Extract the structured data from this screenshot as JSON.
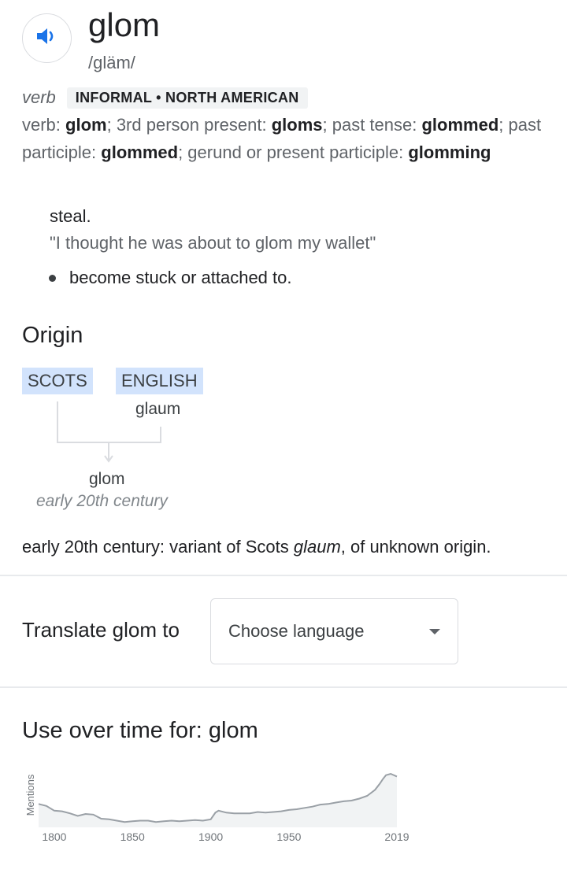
{
  "entry": {
    "speaker_icon": "speaker-icon",
    "headword": "glom",
    "phonetic": "/gläm/",
    "part_of_speech": "verb",
    "register": "INFORMAL • NORTH AMERICAN"
  },
  "forms": {
    "verb_label": "verb: ",
    "verb": "glom",
    "third_label": "; 3rd person present: ",
    "third": "gloms",
    "past_label": "; past tense: ",
    "past": "glommed",
    "pp_label": "; past participle: ",
    "pp": "glommed",
    "gerund_label": "; gerund or present participle: ",
    "gerund": "glomming"
  },
  "senses": {
    "definition": "steal.",
    "example": "\"I thought he was about to glom my wallet\"",
    "sub_sense": "become stuck or attached to."
  },
  "origin": {
    "title": "Origin",
    "languages": [
      "SCOTS",
      "ENGLISH"
    ],
    "source_word": "glaum",
    "result_word": "glom",
    "period": "early 20th century",
    "text_prefix": "early 20th century: variant of Scots ",
    "text_italic": "glaum",
    "text_suffix": ", of unknown origin."
  },
  "translate": {
    "label": "Translate glom to",
    "select_value": "Choose language",
    "caret_icon": "caret-down-icon"
  },
  "usage": {
    "title": "Use over time for: glom"
  },
  "chart_data": {
    "type": "area",
    "title": "",
    "xlabel": "",
    "ylabel": "Mentions",
    "x_ticks": [
      "1800",
      "1850",
      "1900",
      "1950",
      "2019"
    ],
    "xlim": [
      1790,
      2019
    ],
    "ylim": [
      0,
      100
    ],
    "grid": false,
    "color": "#9aa0a6",
    "fill": "#f1f3f4",
    "series": [
      {
        "x": [
          1790,
          1795,
          1800,
          1805,
          1810,
          1815,
          1820,
          1825,
          1830,
          1835,
          1840,
          1845,
          1850,
          1855,
          1860,
          1865,
          1870,
          1875,
          1880,
          1885,
          1890,
          1895,
          1900,
          1903,
          1905,
          1910,
          1915,
          1920,
          1925,
          1930,
          1935,
          1940,
          1945,
          1950,
          1955,
          1960,
          1965,
          1970,
          1975,
          1980,
          1985,
          1990,
          1995,
          2000,
          2005,
          2008,
          2010,
          2012,
          2015,
          2019
        ],
        "values": [
          35,
          32,
          25,
          24,
          21,
          17,
          20,
          19,
          13,
          12,
          10,
          8,
          9,
          10,
          10,
          8,
          9,
          10,
          9,
          10,
          11,
          10,
          12,
          22,
          25,
          22,
          21,
          21,
          21,
          23,
          22,
          23,
          24,
          26,
          27,
          29,
          31,
          34,
          35,
          37,
          39,
          40,
          43,
          47,
          56,
          65,
          72,
          78,
          80,
          76
        ]
      }
    ]
  }
}
